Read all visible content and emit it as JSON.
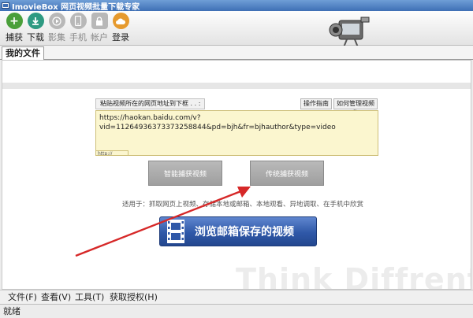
{
  "window": {
    "title": "ImovieBox 网页视频批量下载专家"
  },
  "toolbar": {
    "items": [
      {
        "label": "捕获",
        "icon": "plus-icon",
        "color": "#4a9f3a",
        "enabled": true
      },
      {
        "label": "下载",
        "icon": "download-icon",
        "color": "#2e9a82",
        "enabled": true
      },
      {
        "label": "影集",
        "icon": "play-icon",
        "color": "#b8b8b8",
        "enabled": false
      },
      {
        "label": "手机",
        "icon": "phone-icon",
        "color": "#b8b8b8",
        "enabled": false
      },
      {
        "label": "帐户",
        "icon": "lock-icon",
        "color": "#b8b8b8",
        "enabled": false
      },
      {
        "label": "登录",
        "icon": "cloud-icon",
        "color": "#e69a2e",
        "enabled": true
      }
    ]
  },
  "tabs": [
    {
      "label": "我的文件"
    }
  ],
  "main": {
    "url_label": "粘贴视频所在的网页地址到下框 . . :",
    "guide_button": "操作指南",
    "manage_button": "如何管理视频集",
    "url_value": "https://haokan.baidu.com/v?vid=11264936373373258844&pd=bjh&fr=bjhauthor&type=video",
    "url_hint": "http:// https:// ...",
    "smart_capture_button": "智能捕获视频",
    "legacy_capture_button": "传统捕获视频",
    "usage_text": "适用于：抓取网页上视频、存储本地或邮箱、本地观看、异地调取、在手机中欣赏",
    "mailbox_button": "浏览邮箱保存的视频",
    "watermark": "Think Diffrent"
  },
  "menu": {
    "items": [
      {
        "label": "文件(F)"
      },
      {
        "label": "查看(V)"
      },
      {
        "label": "工具(T)"
      },
      {
        "label": "获取授权(H)"
      }
    ]
  },
  "status": {
    "text": "就绪"
  },
  "colors": {
    "accent_arrow": "#d62828",
    "url_box_bg": "#fbf6cf",
    "mail_button": "#2f58a8"
  }
}
